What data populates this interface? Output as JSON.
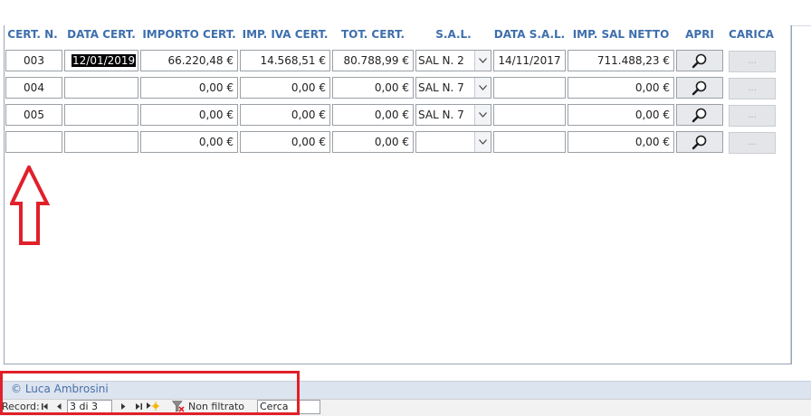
{
  "columns": {
    "cert_n": "CERT. N.",
    "data_cert": "DATA CERT.",
    "importo_cert": "IMPORTO CERT.",
    "imp_iva_cert": "IMP. IVA CERT.",
    "tot_cert": "TOT. CERT.",
    "sal": "S.A.L.",
    "data_sal": "DATA S.A.L.",
    "imp_sal_netto": "IMP. SAL NETTO",
    "apri": "APRI",
    "carica": "CARICA"
  },
  "rows": [
    {
      "cert_n": "003",
      "data_cert": "12/01/2019",
      "importo": "66.220,48 €",
      "iva": "14.568,51 €",
      "tot": "80.788,99 €",
      "sal": "SAL N. 2",
      "data_sal": "14/11/2017",
      "netto": "711.488,23 €",
      "carica": "..."
    },
    {
      "cert_n": "004",
      "data_cert": "",
      "importo": "0,00 €",
      "iva": "0,00 €",
      "tot": "0,00 €",
      "sal": "SAL N. 7",
      "data_sal": "",
      "netto": "0,00 €",
      "carica": "..."
    },
    {
      "cert_n": "005",
      "data_cert": "",
      "importo": "0,00 €",
      "iva": "0,00 €",
      "tot": "0,00 €",
      "sal": "SAL N. 7",
      "data_sal": "",
      "netto": "0,00 €",
      "carica": "..."
    },
    {
      "cert_n": "",
      "data_cert": "",
      "importo": "0,00 €",
      "iva": "0,00 €",
      "tot": "0,00 €",
      "sal": "",
      "data_sal": "",
      "netto": "0,00 €",
      "carica": "..."
    }
  ],
  "footer": {
    "copyright": "© Luca Ambrosini"
  },
  "navigation": {
    "record_label": "Record:",
    "position": "3 di 3",
    "filter_status": "Non filtrato",
    "search_value": "Cerca"
  },
  "colors": {
    "header_text": "#3e6fad",
    "annotation_red": "#e0202a",
    "footer_bar": "#dce4ef"
  },
  "icons": {
    "open": "magnifier-icon",
    "calendar": "calendar-icon",
    "dropdown": "chevron-down-icon",
    "filter": "funnel-icon",
    "annotation": "red-up-arrow"
  }
}
